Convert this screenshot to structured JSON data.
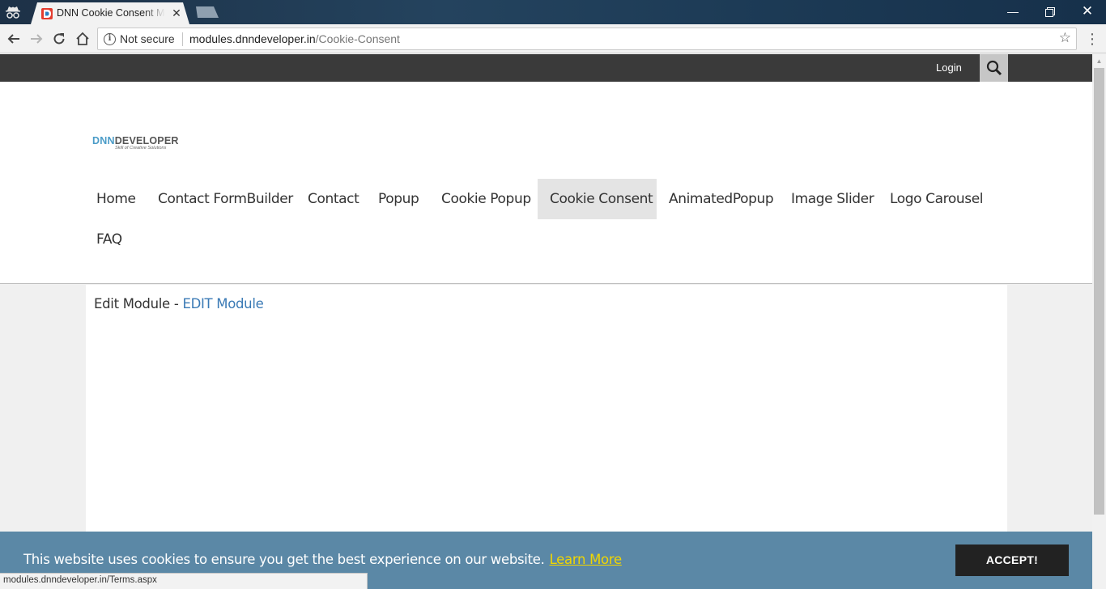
{
  "browser": {
    "tab_title": "DNN Cookie Consent Module",
    "security_label": "Not secure",
    "url_host": "modules.dnndeveloper.in",
    "url_path": "/Cookie-Consent",
    "status_url": "modules.dnndeveloper.in/Terms.aspx"
  },
  "site": {
    "login_label": "Login",
    "logo_prefix": "DNN",
    "logo_suffix": "DEVELOPER",
    "logo_tagline": "Skill of Creative Solutions"
  },
  "menu": {
    "items": [
      {
        "label": "Home"
      },
      {
        "label": "Contact FormBuilder"
      },
      {
        "label": "Contact"
      },
      {
        "label": "Popup"
      },
      {
        "label": "Cookie Popup"
      },
      {
        "label": "Cookie Consent",
        "active": true
      },
      {
        "label": "AnimatedPopup"
      },
      {
        "label": "Image Slider"
      },
      {
        "label": "Logo Carousel"
      },
      {
        "label": "FAQ"
      }
    ]
  },
  "content": {
    "edit_prefix": "Edit Module - ",
    "edit_link": "EDIT Module"
  },
  "cookie": {
    "message": "This website uses cookies to ensure you get the best experience on our website.",
    "learn_more": "Learn More",
    "accept": "ACCEPT!"
  },
  "colors": {
    "topbar": "#3a3a3a",
    "cookie_bar": "#5b88a6",
    "learn_more": "#f1d600",
    "link": "#3a7ab5",
    "active_menu_bg": "#e4e4e4"
  }
}
